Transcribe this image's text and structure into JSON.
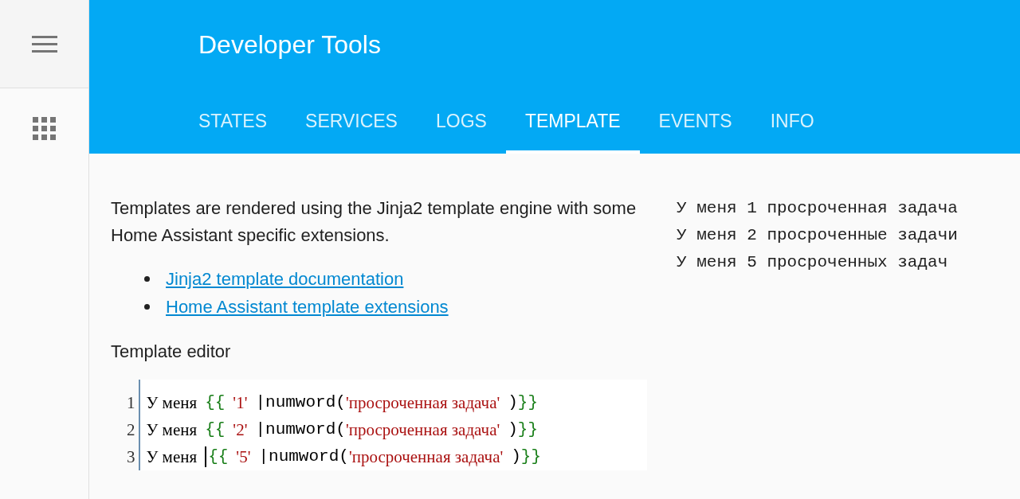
{
  "sidebar": {
    "items": [
      {
        "kind": "menu",
        "selected": false
      },
      {
        "kind": "apps",
        "selected": false
      }
    ]
  },
  "header": {
    "title": "Developer Tools"
  },
  "tabs": [
    {
      "label": "STATES",
      "selected": false
    },
    {
      "label": "SERVICES",
      "selected": false
    },
    {
      "label": "LOGS",
      "selected": false
    },
    {
      "label": "TEMPLATE",
      "selected": true
    },
    {
      "label": "EVENTS",
      "selected": false
    },
    {
      "label": "INFO",
      "selected": false
    }
  ],
  "intro": "Templates are rendered using the Jinja2 template engine with some Home Assistant specific extensions.",
  "links": [
    "Jinja2 template documentation",
    "Home Assistant template extensions"
  ],
  "editor_label": "Template editor",
  "editor": {
    "lines": [
      {
        "number": "1",
        "tokens": [
          {
            "kind": "text",
            "text": "У меня"
          },
          {
            "kind": "bracket",
            "text": "{{"
          },
          {
            "kind": "string",
            "text": "'1'"
          },
          {
            "kind": "pipe",
            "text": "|"
          },
          {
            "kind": "name",
            "text": "numword("
          },
          {
            "kind": "string",
            "text": "'просроченная задача'"
          },
          {
            "kind": "name",
            "text": ")"
          },
          {
            "kind": "bracket",
            "text": "}}"
          }
        ]
      },
      {
        "number": "2",
        "tokens": [
          {
            "kind": "text",
            "text": "У меня"
          },
          {
            "kind": "bracket",
            "text": "{{"
          },
          {
            "kind": "string",
            "text": "'2'"
          },
          {
            "kind": "pipe",
            "text": "|"
          },
          {
            "kind": "name",
            "text": "numword("
          },
          {
            "kind": "string",
            "text": "'просроченная задача'"
          },
          {
            "kind": "name",
            "text": ")"
          },
          {
            "kind": "bracket",
            "text": "}}"
          }
        ]
      },
      {
        "number": "3",
        "tokens": [
          {
            "kind": "text",
            "text": "У меня"
          },
          {
            "kind": "cursor"
          },
          {
            "kind": "bracket",
            "text": "{{"
          },
          {
            "kind": "string",
            "text": "'5'"
          },
          {
            "kind": "pipe",
            "text": "|"
          },
          {
            "kind": "name",
            "text": "numword("
          },
          {
            "kind": "string",
            "text": "'просроченная задача'"
          },
          {
            "kind": "name",
            "text": ")"
          },
          {
            "kind": "bracket",
            "text": "}}"
          }
        ]
      }
    ]
  },
  "output": [
    "У меня 1 просроченная задача",
    "У меня 2 просроченные задачи",
    "У меня 5 просроченных задач"
  ]
}
